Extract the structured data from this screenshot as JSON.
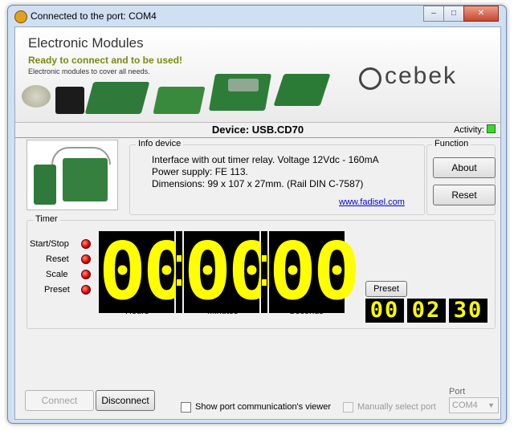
{
  "window": {
    "title": "Connected to the port: COM4",
    "controls": {
      "minimize": "–",
      "maximize": "□",
      "close": "✕"
    }
  },
  "banner": {
    "title": "Electronic Modules",
    "subtitle": "Ready to connect and to be used!",
    "tagline": "Electronic modules to cover all needs.",
    "logo": "cebek"
  },
  "device": {
    "label": "Device: USB.CD70"
  },
  "activity": {
    "label": "Activity:",
    "color": "#3fd62f"
  },
  "info": {
    "group_label": "Info device",
    "lines": [
      "Interface with out timer relay.  Voltage 12Vdc - 160mA",
      "Power supply: FE 113.",
      "Dimensions: 99 x 107 x 27mm. (Rail DIN C-7587)"
    ],
    "link": "www.fadisel.com"
  },
  "function": {
    "group_label": "Function",
    "about": "About",
    "reset": "Reset"
  },
  "timer": {
    "group_label": "Timer",
    "indicators": [
      "Start/Stop",
      "Reset",
      "Scale",
      "Preset"
    ],
    "hours": "00",
    "minutes": "00",
    "seconds": "00",
    "hours_label": "Hours",
    "minutes_label": "Minutes",
    "seconds_label": "Seconds",
    "preset_button": "Preset",
    "preset_hours": "00",
    "preset_minutes": "02",
    "preset_seconds": "30"
  },
  "bottom": {
    "connect": "Connect",
    "disconnect": "Disconnect",
    "show_viewer": "Show port communication's viewer",
    "manual_select": "Manually select port",
    "port_label": "Port",
    "port_value": "COM4"
  },
  "colors": {
    "digit_on": "#ffff00",
    "digit_bg": "#000000",
    "led": "#d40000"
  }
}
